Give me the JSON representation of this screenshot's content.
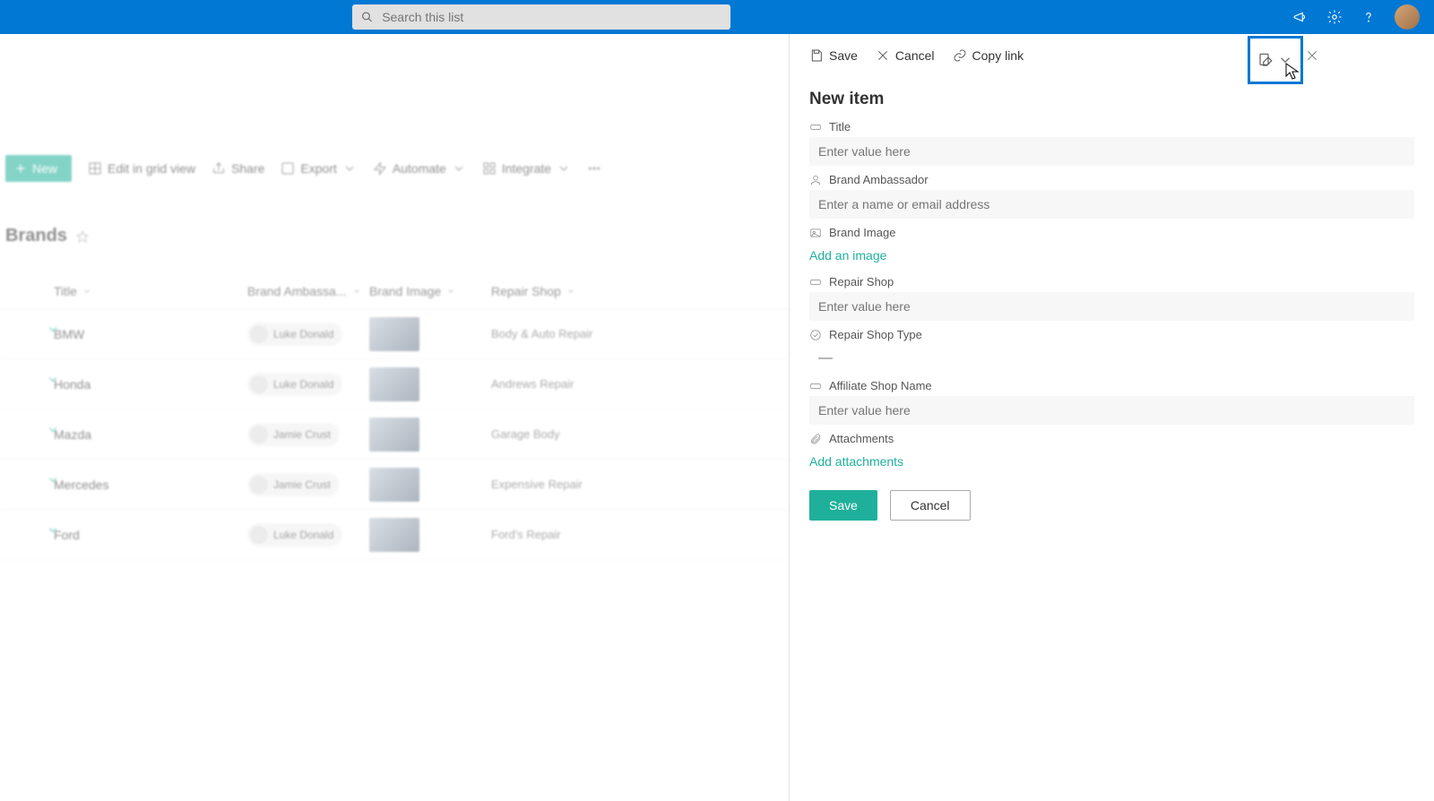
{
  "topbar": {
    "search_placeholder": "Search this list"
  },
  "toolbar": {
    "new": "New",
    "edit_grid": "Edit in grid view",
    "share": "Share",
    "export": "Export",
    "automate": "Automate",
    "integrate": "Integrate"
  },
  "list": {
    "title": "Brands",
    "columns": {
      "title": "Title",
      "ambassador": "Brand Ambassa...",
      "image": "Brand Image",
      "shop": "Repair Shop"
    },
    "rows": [
      {
        "title": "BMW",
        "ambassador": "Luke Donald",
        "shop": "Body & Auto Repair"
      },
      {
        "title": "Honda",
        "ambassador": "Luke Donald",
        "shop": "Andrews Repair"
      },
      {
        "title": "Mazda",
        "ambassador": "Jamie Crust",
        "shop": "Garage Body"
      },
      {
        "title": "Mercedes",
        "ambassador": "Jamie Crust",
        "shop": "Expensive Repair"
      },
      {
        "title": "Ford",
        "ambassador": "Luke Donald",
        "shop": "Ford's Repair"
      }
    ]
  },
  "panel": {
    "toolbar": {
      "save": "Save",
      "cancel": "Cancel",
      "copylink": "Copy link"
    },
    "title": "New item",
    "fields": {
      "title_label": "Title",
      "title_placeholder": "Enter value here",
      "ambassador_label": "Brand Ambassador",
      "ambassador_placeholder": "Enter a name or email address",
      "image_label": "Brand Image",
      "image_action": "Add an image",
      "shop_label": "Repair Shop",
      "shop_placeholder": "Enter value here",
      "shoptype_label": "Repair Shop Type",
      "shoptype_value": "—",
      "affiliate_label": "Affiliate Shop Name",
      "affiliate_placeholder": "Enter value here",
      "attachments_label": "Attachments",
      "attachments_action": "Add attachments"
    },
    "buttons": {
      "save": "Save",
      "cancel": "Cancel"
    }
  }
}
